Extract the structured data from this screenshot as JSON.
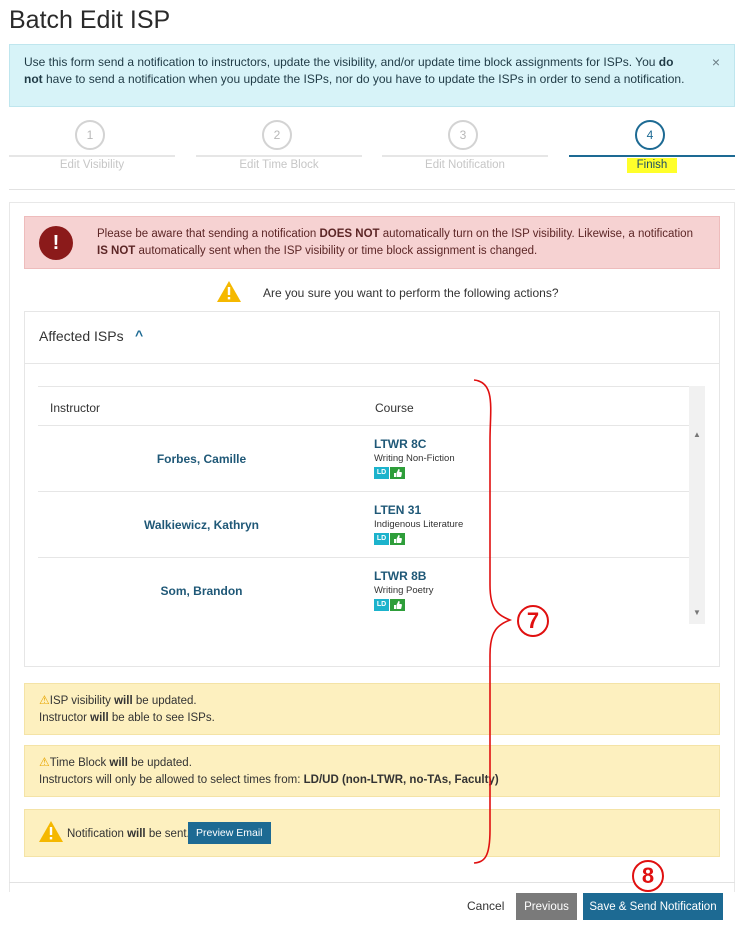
{
  "page": {
    "title": "Batch Edit ISP"
  },
  "info": {
    "text_before": "Use this form send a notification to instructors, update the visibility, and/or update time block assignments for ISPs. You ",
    "bold": "do not",
    "text_after": " have to send a notification when you update the ISPs, nor do you have to update the ISPs in order to send a notification.",
    "close": "×"
  },
  "steps": [
    {
      "num": "1",
      "label": "Edit Visibility"
    },
    {
      "num": "2",
      "label": "Edit Time Block"
    },
    {
      "num": "3",
      "label": "Edit Notification"
    },
    {
      "num": "4",
      "label": "Finish"
    }
  ],
  "danger": {
    "icon": "!",
    "p1": "Please be aware that sending a notification ",
    "b1": "DOES NOT",
    "p2": " automatically turn on the ISP visibility. Likewise, a notification ",
    "b2": "IS NOT",
    "p3": " automatically sent when the ISP visibility or time block assignment is changed."
  },
  "confirm": {
    "text": "Are you sure you want to perform the following actions?"
  },
  "affected": {
    "title": "Affected ISPs",
    "chevron": "^",
    "headers": {
      "instructor": "Instructor",
      "course": "Course"
    },
    "rows": [
      {
        "instructor": "Forbes, Camille",
        "code": "LTWR 8C",
        "name": "Writing Non-Fiction",
        "badge": "LD"
      },
      {
        "instructor": "Walkiewicz, Kathryn",
        "code": "LTEN 31",
        "name": "Indigenous Literature",
        "badge": "LD"
      },
      {
        "instructor": "Som, Brandon",
        "code": "LTWR 8B",
        "name": "Writing Poetry",
        "badge": "LD"
      }
    ]
  },
  "warnings": {
    "w1": {
      "a": "ISP visibility ",
      "b": "will",
      "c": " be updated.",
      "d": "Instructor ",
      "e": "will",
      "f": " be able to see ISPs."
    },
    "w2": {
      "a": "Time Block ",
      "b": "will",
      "c": " be updated.",
      "d": "Instructors will only be allowed to select times from: ",
      "e": "LD/UD (non-LTWR, no-TAs, Faculty)"
    },
    "w3": {
      "a": "Notification ",
      "b": "will",
      "c": " be sent.",
      "button": "Preview Email"
    }
  },
  "footer": {
    "cancel": "Cancel",
    "previous": "Previous",
    "save": "Save & Send Notification"
  },
  "annotations": {
    "a7": "7",
    "a8": "8"
  },
  "colors": {
    "primary": "#1d6a93",
    "highlight": "#ffff2a",
    "danger_bg": "#f6d2d2",
    "warning_bg": "#fdf0bf",
    "info_bg": "#d7f3f8",
    "annotation": "#e01010"
  }
}
